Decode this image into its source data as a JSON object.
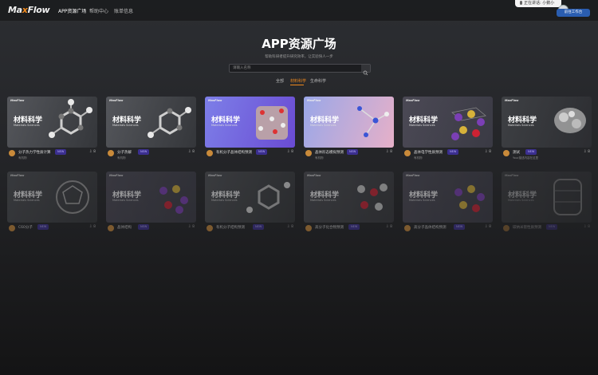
{
  "app": {
    "logo_a": "Ma",
    "logo_x": "x",
    "logo_b": "Flow"
  },
  "nav": [
    {
      "label": "APP资源广场"
    },
    {
      "label": "帮助中心"
    },
    {
      "label": "账单信息"
    }
  ],
  "status_text": "正在讲话: 小鹅小",
  "workbench_label": "前往工作台",
  "page": {
    "title": "APP资源广场",
    "subtitle": "帮助科研者提升研究效率，让实验快人一步"
  },
  "search": {
    "placeholder": "请输入名称"
  },
  "tabs": [
    {
      "label": "全部"
    },
    {
      "label": "材料科学"
    },
    {
      "label": "生命科学"
    }
  ],
  "thumb": {
    "logo": "MaxFlow",
    "title": "材料科学",
    "subtitle": "Materials Sciences"
  },
  "cards": [
    {
      "name": "分子热力学性质计算",
      "new": "NEW",
      "author": "有机物",
      "downloads": "8"
    },
    {
      "name": "分子热解",
      "new": "NEW",
      "author": "有机物",
      "downloads": "8"
    },
    {
      "name": "有机分子晶体结构预测",
      "new": "NEW",
      "author": "",
      "downloads": "8"
    },
    {
      "name": "晶体形态模拟预测",
      "new": "NEW",
      "author": "有机物",
      "downloads": "8"
    },
    {
      "name": "晶体电学性质预测",
      "new": "NEW",
      "author": "有机物",
      "downloads": "8"
    },
    {
      "name": "测试",
      "new": "NEW",
      "author": "Your描述内容在这里",
      "downloads": "8"
    },
    {
      "name": "C60分子",
      "new": "NEW",
      "author": "",
      "downloads": "8"
    },
    {
      "name": "晶体结构",
      "new": "NEW",
      "author": "",
      "downloads": "8"
    },
    {
      "name": "有机分子结构预测",
      "new": "NEW",
      "author": "",
      "downloads": "8"
    },
    {
      "name": "高分子化合物预测",
      "new": "NEW",
      "author": "",
      "downloads": "8"
    },
    {
      "name": "高分子晶体结构预测",
      "new": "NEW",
      "author": "",
      "downloads": "8"
    },
    {
      "name": "碳纳米管性质预测",
      "new": "NEW",
      "author": "",
      "downloads": "8"
    }
  ],
  "colors": {
    "accent": "#f08a1e",
    "badge_bg": "#3b2f8f",
    "work_button": "#2a5db0"
  }
}
